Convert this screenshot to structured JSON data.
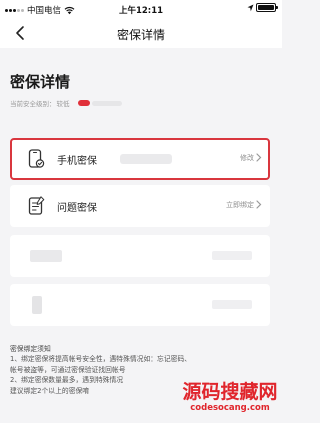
{
  "status_bar": {
    "carrier": "中国电信",
    "time": "上午12:11",
    "icons": [
      "signal-icon",
      "wifi-icon",
      "location-icon",
      "battery-icon"
    ]
  },
  "nav": {
    "title": "密保详情",
    "back_icon": "chevron-left-icon"
  },
  "header": {
    "title": "密保详情",
    "level_label": "当前安全级别：",
    "level_value": "较低",
    "level_color": "#e0303a"
  },
  "items": [
    {
      "label": "手机密保",
      "action": "修改",
      "icon": "phone-shield-icon",
      "highlighted": true,
      "highlight_color": "#d9363e"
    },
    {
      "label": "问题密保",
      "action": "立即绑定",
      "icon": "question-note-icon",
      "highlighted": false
    }
  ],
  "notes": {
    "title": "密保绑定须知",
    "lines": [
      "1、绑定密保将提高帐号安全性，遇特殊情况如：忘记密码、",
      "帐号被盗等，可通过密保验证找回帐号",
      "2、绑定密保数量最多，遇到特殊情况",
      "建议绑定2个以上的密保唷"
    ]
  },
  "watermark": {
    "text": "源码搜藏网",
    "url": "codesocang.com",
    "color": "#e0252c"
  }
}
